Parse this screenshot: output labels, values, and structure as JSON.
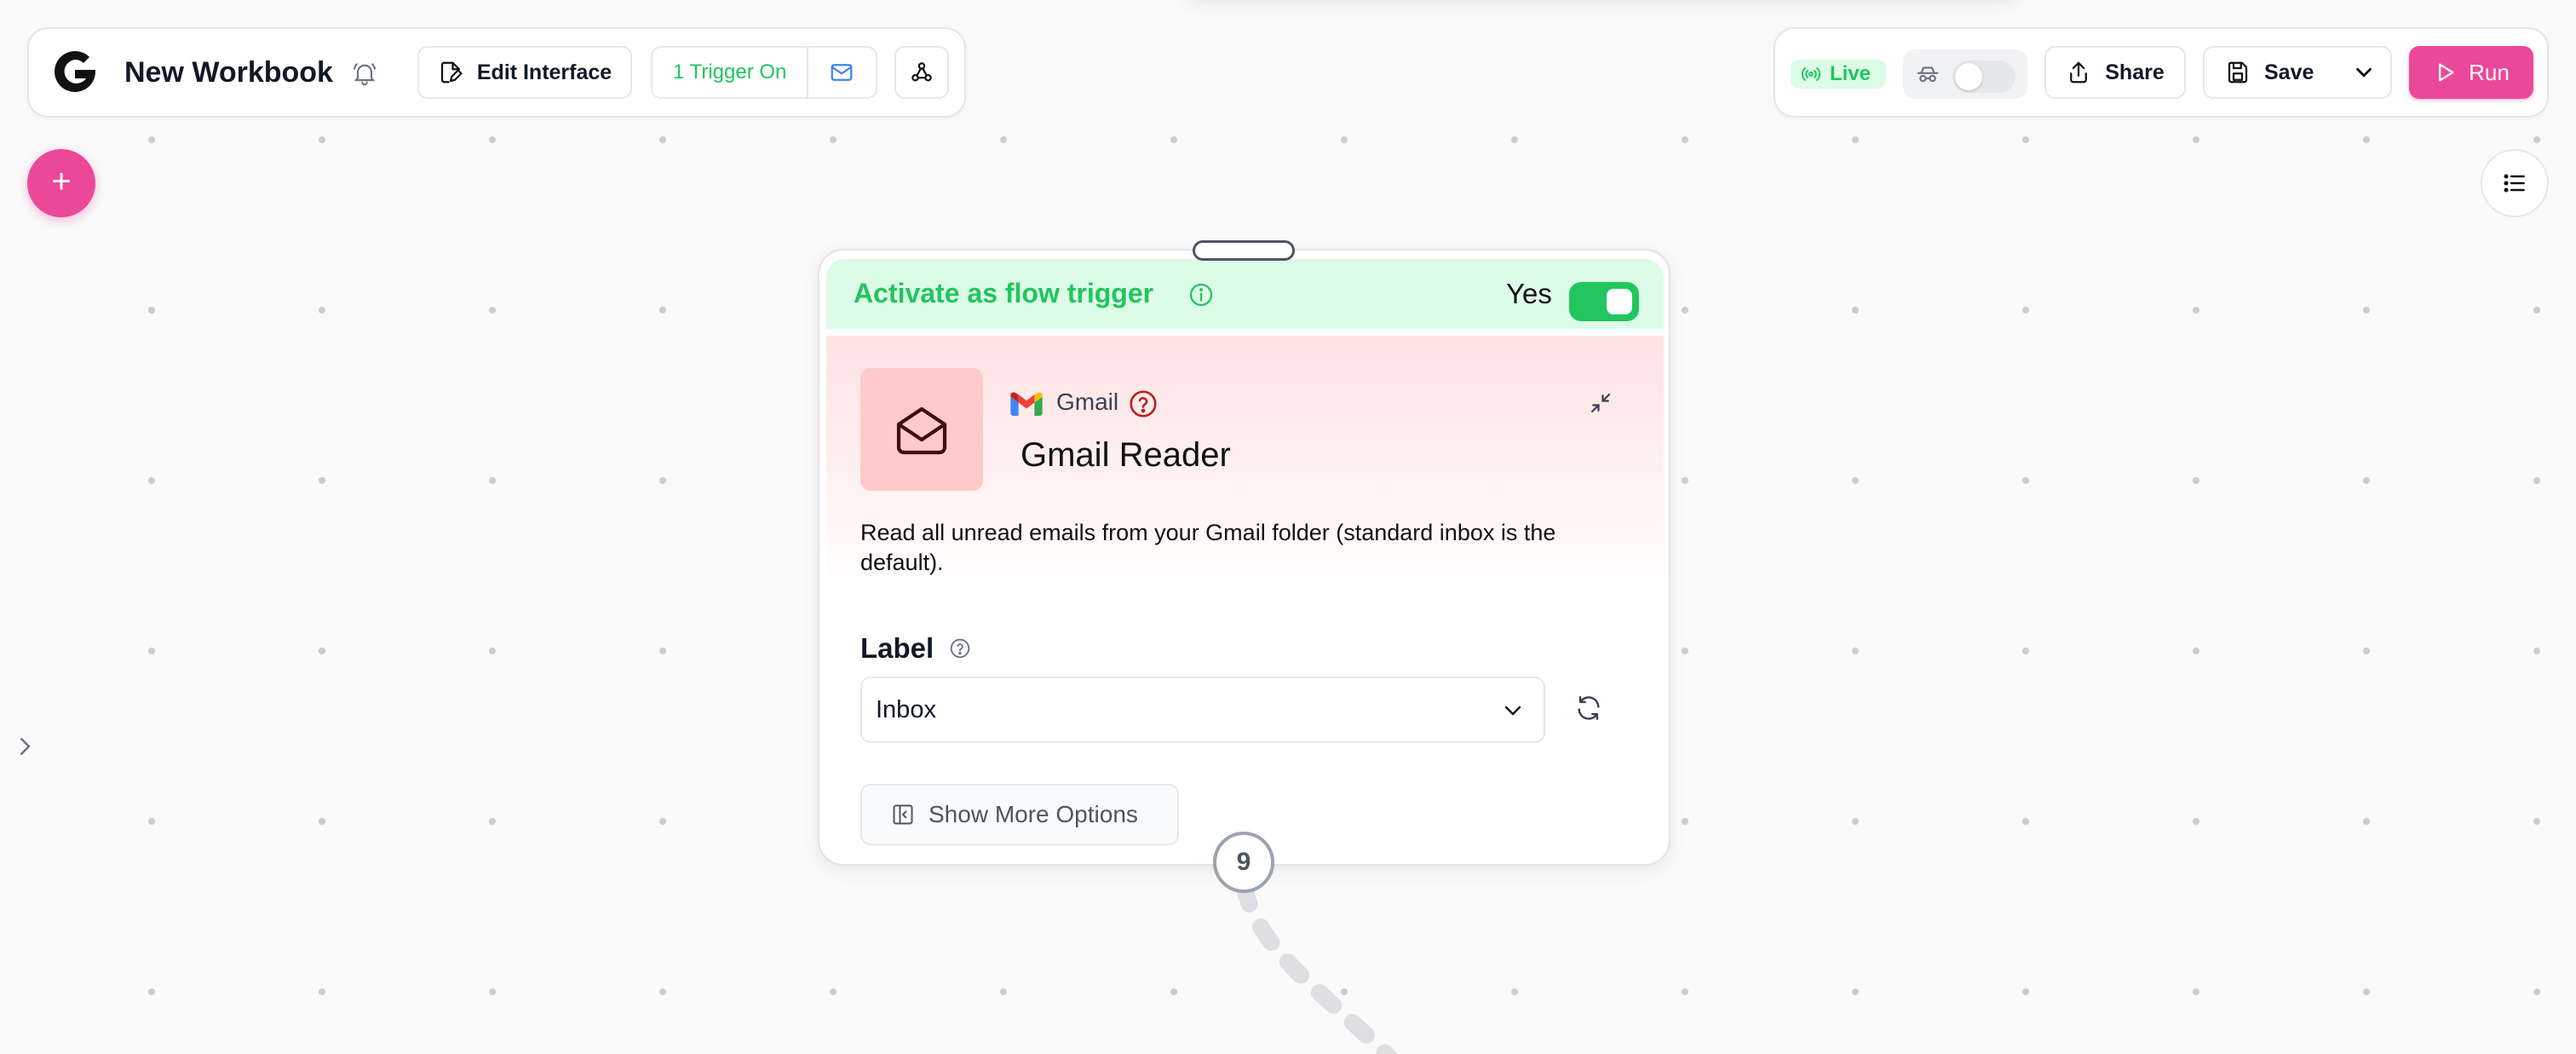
{
  "header": {
    "workbook_title": "New Workbook",
    "edit_interface_label": "Edit Interface",
    "trigger_status_label": "1 Trigger On",
    "live_label": "Live",
    "share_label": "Share",
    "save_label": "Save",
    "run_label": "Run"
  },
  "canvas": {
    "add_node_symbol": "+"
  },
  "node": {
    "trigger_band": {
      "label": "Activate as flow trigger",
      "toggle_text": "Yes",
      "toggle_on": true
    },
    "app_name": "Gmail",
    "title": "Gmail Reader",
    "description": "Read all unread emails from your Gmail folder (standard inbox is the default).",
    "label_field": {
      "label": "Label",
      "value": "Inbox"
    },
    "show_more_label": "Show More Options",
    "step_number": "9"
  },
  "colors": {
    "accent_pink": "#ec4899",
    "trigger_green": "#22c55e",
    "trigger_band_bg": "#dcfce7",
    "icon_tile_bg": "#fecaca",
    "help_red": "#b91c1c"
  }
}
